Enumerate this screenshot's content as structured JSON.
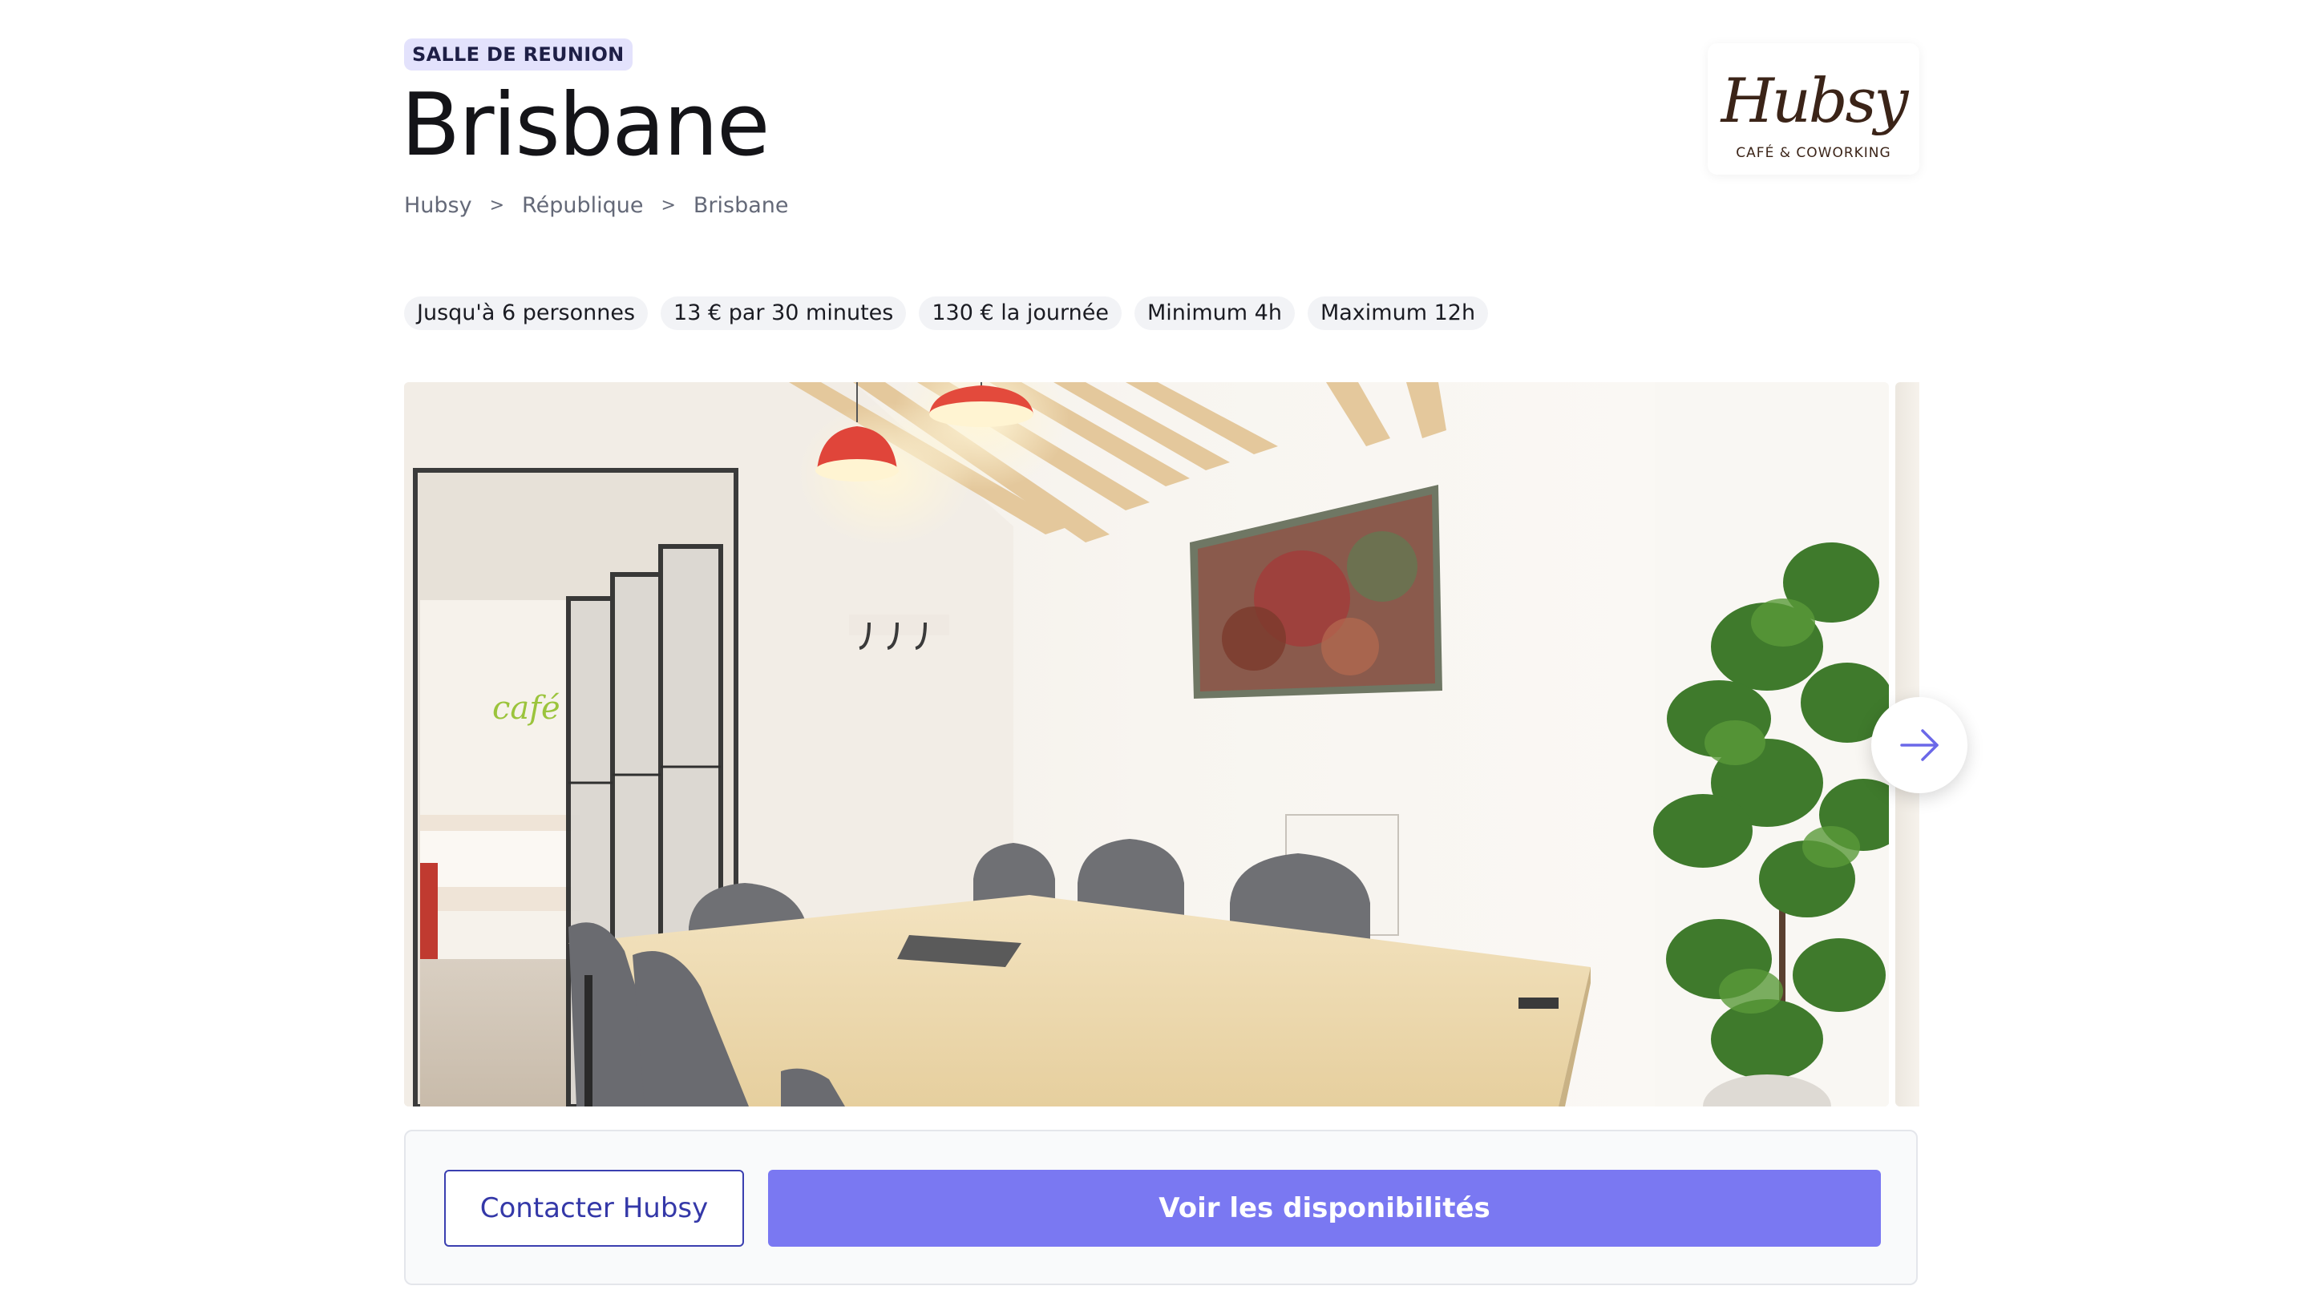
{
  "listing": {
    "category_badge": "SALLE DE REUNION",
    "title": "Brisbane",
    "breadcrumb": [
      "Hubsy",
      "République",
      "Brisbane"
    ],
    "breadcrumb_separator": ">"
  },
  "brand_logo": {
    "wordmark": "Hubsy",
    "tagline": "CAFÉ & COWORKING",
    "color": "#3b2418"
  },
  "features": [
    "Jusqu'à 6 personnes",
    "13 € par 30 minutes",
    "130 € la journée",
    "Minimum 4h",
    "Maximum 12h"
  ],
  "gallery": {
    "main_photo": "meeting-room-photo",
    "sign_text": "café",
    "next_icon": "arrow-right-icon",
    "accent": "#6b68e8"
  },
  "actions": {
    "contact_label": "Contacter Hubsy",
    "availability_label": "Voir les disponibilités"
  },
  "colors": {
    "primary": "#7a78f2",
    "badge_bg": "#e3e2fc",
    "contact_border": "#3b3fb0"
  }
}
